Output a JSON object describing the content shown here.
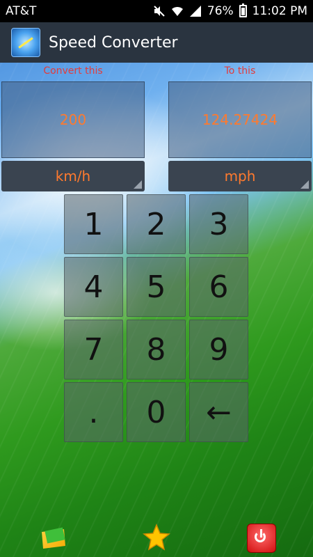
{
  "status_bar": {
    "carrier": "AT&T",
    "battery": "76%",
    "time": "11:02 PM"
  },
  "app_bar": {
    "title": "Speed Converter"
  },
  "converter": {
    "from_label": "Convert this",
    "to_label": "To this",
    "from_value": "200",
    "to_value": "124.27424",
    "from_unit": "km/h",
    "to_unit": "mph"
  },
  "keypad": {
    "keys": [
      "1",
      "2",
      "3",
      "4",
      "5",
      "6",
      "7",
      "8",
      "9",
      ".",
      "0",
      "←"
    ]
  },
  "bottom_bar": {
    "icons": [
      "share-mail-icon",
      "favorite-star-icon",
      "power-exit-icon"
    ]
  },
  "colors": {
    "label_red": "#e23b3b",
    "value_orange": "#ff7a2e"
  }
}
